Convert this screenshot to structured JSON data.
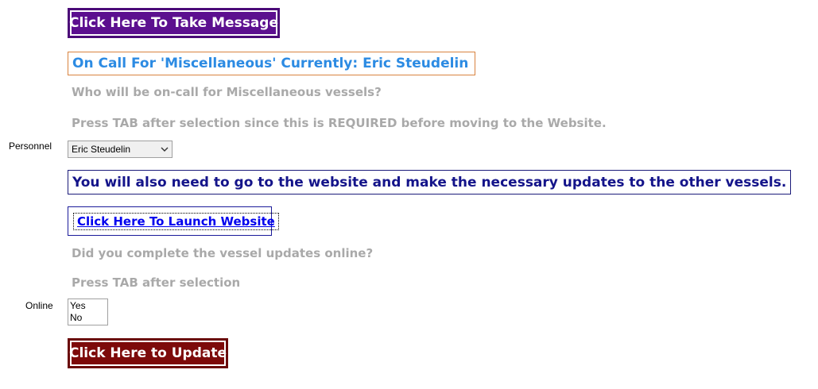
{
  "take_message": {
    "label": "Click Here To Take Message",
    "bg_color": "#5c0f8f"
  },
  "on_call": {
    "text": "On Call For 'Miscellaneous' Currently: Eric Steudelin",
    "color": "#2c8be3",
    "border_color": "#d9833f"
  },
  "question_personnel": "Who will be on-call for Miscellaneous vessels?",
  "instruction_personnel": "Press TAB after selection since this is REQUIRED before moving to the Website.",
  "personnel": {
    "label": "Personnel",
    "selected": "Eric Steudelin",
    "icon": "chevron-down-icon"
  },
  "notice": {
    "text": "You will also need to go to the website and make the necessary updates to the other vessels.",
    "color": "#14148a"
  },
  "launch_website": {
    "label": "Click Here To Launch Website"
  },
  "question_online": "Did you complete the vessel updates online?",
  "instruction_online": "Press TAB after selection",
  "online": {
    "label": "Online",
    "options": [
      "Yes",
      "No"
    ]
  },
  "update": {
    "label": "Click Here to Update",
    "bg_color": "#7d0a0a"
  }
}
